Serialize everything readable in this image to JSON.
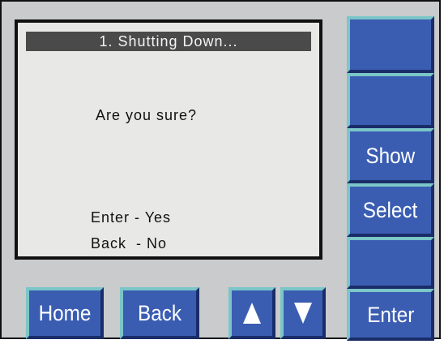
{
  "screen": {
    "title": "1. Shutting Down...",
    "prompt": "Are you sure?",
    "option_yes": "Enter - Yes",
    "option_no": "Back  - No"
  },
  "side_buttons": {
    "blank_1": "",
    "blank_2": "",
    "show": "Show",
    "select": "Select",
    "blank_3": "",
    "enter": "Enter"
  },
  "bottom_buttons": {
    "home": "Home",
    "back": "Back",
    "up_icon": "up-arrow-icon",
    "down_icon": "down-arrow-icon"
  },
  "colors": {
    "button_face": "#3a5db2",
    "button_highlight": "#7bc6c8",
    "button_shadow": "#1a2d69",
    "panel": "#c9cbcd",
    "screen": "#e8e8e6",
    "title_bar": "#4a4a4a"
  }
}
